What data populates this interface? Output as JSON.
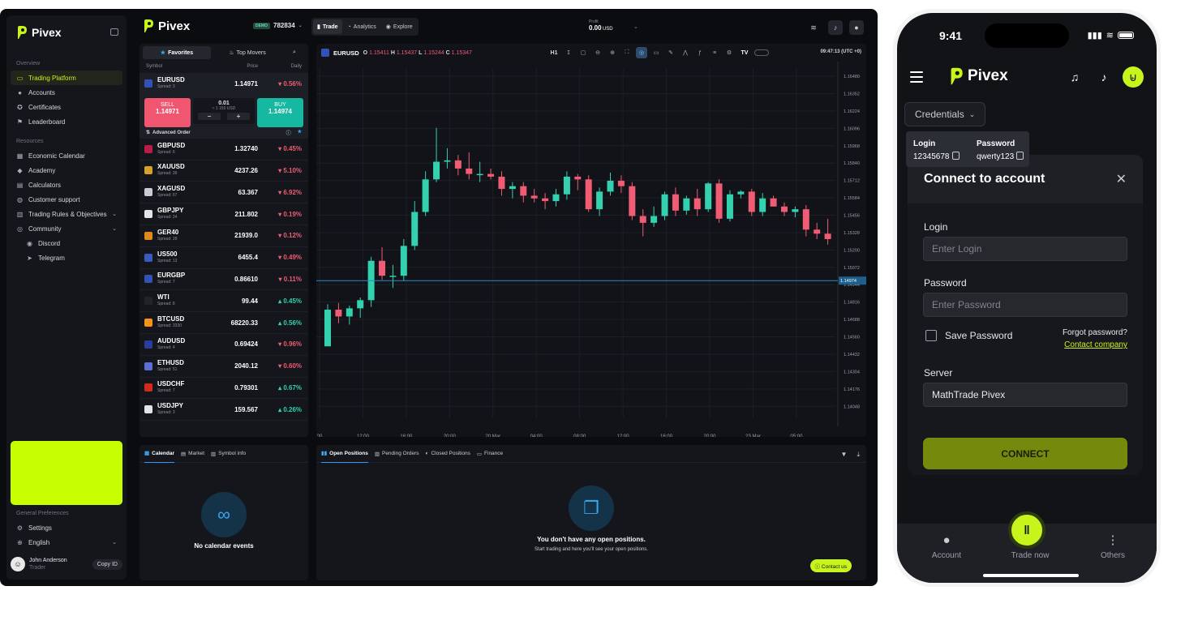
{
  "brand": "Pivex",
  "sidebar": {
    "overview_title": "Overview",
    "overview_items": [
      {
        "label": "Trading Platform",
        "icon": "monitor-icon",
        "active": true
      },
      {
        "label": "Accounts",
        "icon": "user-icon"
      },
      {
        "label": "Certificates",
        "icon": "award-icon"
      },
      {
        "label": "Leaderboard",
        "icon": "flag-icon"
      }
    ],
    "resources_title": "Resources",
    "resources_items": [
      {
        "label": "Economic Calendar",
        "icon": "calendar-icon"
      },
      {
        "label": "Academy",
        "icon": "graduation-icon"
      },
      {
        "label": "Calculators",
        "icon": "calculator-icon"
      },
      {
        "label": "Customer support",
        "icon": "support-icon"
      },
      {
        "label": "Trading Rules & Objectives",
        "icon": "book-icon",
        "chevron": true
      },
      {
        "label": "Community",
        "icon": "globe-icon",
        "chevron": true
      }
    ],
    "community_items": [
      {
        "label": "Discord",
        "icon": "discord-icon"
      },
      {
        "label": "Telegram",
        "icon": "telegram-icon"
      }
    ],
    "prefs_title": "General Preferences",
    "prefs_items": [
      {
        "label": "Settings",
        "icon": "gear-icon"
      },
      {
        "label": "English",
        "icon": "uk-flag-icon",
        "chevron": true
      }
    ],
    "user": {
      "name": "John Anderson",
      "role": "Trader",
      "copy_label": "Copy ID"
    }
  },
  "topbar": {
    "account_badge": "DEMO",
    "account_id": "782834",
    "tabs": [
      "Trade",
      "Analytics",
      "Explore"
    ],
    "profit_label": "Profit",
    "profit_value": "0.00",
    "profit_currency": "USD"
  },
  "watchlist": {
    "tabs": [
      "Favorites",
      "Top Movers"
    ],
    "columns": [
      "Symbol",
      "Price",
      "Daily"
    ],
    "selected": {
      "symbol": "EURUSD",
      "spread": "Spread: 3",
      "price": "1.14971",
      "change": "0.56%",
      "dir": "neg"
    },
    "trade": {
      "sell_label": "SELL",
      "sell_price": "1.14971",
      "buy_label": "BUY",
      "buy_price": "1.14974",
      "lot": "0.01",
      "lot_value": "≈ 1 150 USD",
      "minus": "−",
      "plus": "+"
    },
    "advanced_label": "Advanced Order",
    "rows": [
      {
        "symbol": "GBPUSD",
        "spread": "Spread: 6",
        "price": "1.32740",
        "change": "0.45%",
        "dir": "neg",
        "color": "#b91d47"
      },
      {
        "symbol": "XAUUSD",
        "spread": "Spread: 39",
        "price": "4237.26",
        "change": "5.10%",
        "dir": "neg",
        "color": "#d4a12a"
      },
      {
        "symbol": "XAGUSD",
        "spread": "Spread: 67",
        "price": "63.367",
        "change": "6.92%",
        "dir": "neg",
        "color": "#c9cdd3"
      },
      {
        "symbol": "GBPJPY",
        "spread": "Spread: 24",
        "price": "211.802",
        "change": "0.19%",
        "dir": "neg",
        "color": "#e2e4e8"
      },
      {
        "symbol": "GER40",
        "spread": "Spread: 28",
        "price": "21939.0",
        "change": "0.12%",
        "dir": "neg",
        "color": "#e08a1e"
      },
      {
        "symbol": "US500",
        "spread": "Spread: 13",
        "price": "6455.4",
        "change": "0.49%",
        "dir": "neg",
        "color": "#3a5bbf"
      },
      {
        "symbol": "EURGBP",
        "spread": "Spread: 7",
        "price": "0.86610",
        "change": "0.11%",
        "dir": "neg",
        "color": "#3352b8"
      },
      {
        "symbol": "WTI",
        "spread": "Spread: 8",
        "price": "99.44",
        "change": "0.45%",
        "dir": "pos",
        "color": "#222428"
      },
      {
        "symbol": "BTCUSD",
        "spread": "Spread: 3330",
        "price": "68220.33",
        "change": "0.56%",
        "dir": "pos",
        "color": "#f7931a"
      },
      {
        "symbol": "AUDUSD",
        "spread": "Spread: 4",
        "price": "0.69424",
        "change": "0.96%",
        "dir": "neg",
        "color": "#2a3d9b"
      },
      {
        "symbol": "ETHUSD",
        "spread": "Spread: 51",
        "price": "2040.12",
        "change": "0.60%",
        "dir": "neg",
        "color": "#5b6fd6"
      },
      {
        "symbol": "USDCHF",
        "spread": "Spread: 7",
        "price": "0.79301",
        "change": "0.67%",
        "dir": "pos",
        "color": "#d52b1e"
      },
      {
        "symbol": "USDJPY",
        "spread": "Spread: 3",
        "price": "159.567",
        "change": "0.26%",
        "dir": "pos",
        "color": "#e2e4e8"
      }
    ]
  },
  "chart": {
    "symbol": "EURUSD",
    "open_label": "O",
    "open": "1.15411",
    "high_label": "H",
    "high": "1.15437",
    "low_label": "L",
    "low": "1.15244",
    "close_label": "C",
    "close": "1.15347",
    "timeframe": "H1",
    "time": "09:47:13 (UTC +0)",
    "tv_logo": "TV"
  },
  "chart_data": {
    "type": "candlestick",
    "symbol": "EURUSD",
    "timeframe": "H1",
    "ylim": [
      1.1396,
      1.1654
    ],
    "y_ticks": [
      "1.16480",
      "1.16352",
      "1.16224",
      "1.16096",
      "1.15968",
      "1.15840",
      "1.15712",
      "1.15584",
      "1.15456",
      "1.15328",
      "1.15200",
      "1.15072",
      "1.14944",
      "1.14816",
      "1.14688",
      "1.14560",
      "1.14432",
      "1.14304",
      "1.14176",
      "1.14048"
    ],
    "x_ticks": [
      "00",
      "12:00",
      "16:00",
      "20:00",
      "20 Mar",
      "04:00",
      "08:00",
      "12:00",
      "16:00",
      "20:00",
      "23 Mar",
      "05:00"
    ],
    "current_price": "1.14974",
    "ohlc": [
      [
        1.1449,
        1.148,
        1.1449,
        1.1476
      ],
      [
        1.1476,
        1.1481,
        1.1466,
        1.1471
      ],
      [
        1.1471,
        1.1479,
        1.1465,
        1.1477
      ],
      [
        1.1477,
        1.1485,
        1.147,
        1.1483
      ],
      [
        1.1483,
        1.1515,
        1.1478,
        1.1512
      ],
      [
        1.1512,
        1.1522,
        1.1498,
        1.1501
      ],
      [
        1.1501,
        1.1509,
        1.1492,
        1.1501
      ],
      [
        1.1501,
        1.1528,
        1.1497,
        1.1523
      ],
      [
        1.1523,
        1.1556,
        1.152,
        1.1548
      ],
      [
        1.1548,
        1.1578,
        1.1545,
        1.1572
      ],
      [
        1.1572,
        1.161,
        1.157,
        1.1585
      ],
      [
        1.1585,
        1.1595,
        1.158,
        1.1586
      ],
      [
        1.1586,
        1.159,
        1.1575,
        1.158
      ],
      [
        1.158,
        1.1592,
        1.1572,
        1.1576
      ],
      [
        1.1576,
        1.1585,
        1.157,
        1.1576
      ],
      [
        1.1576,
        1.158,
        1.1572,
        1.1574
      ],
      [
        1.1574,
        1.1578,
        1.156,
        1.1565
      ],
      [
        1.1565,
        1.157,
        1.1558,
        1.1567
      ],
      [
        1.1567,
        1.157,
        1.1555,
        1.156
      ],
      [
        1.156,
        1.1565,
        1.1555,
        1.1558
      ],
      [
        1.1558,
        1.1562,
        1.155,
        1.1556
      ],
      [
        1.1556,
        1.1565,
        1.1552,
        1.1561
      ],
      [
        1.1561,
        1.1578,
        1.1557,
        1.1574
      ],
      [
        1.1574,
        1.1576,
        1.1564,
        1.1572
      ],
      [
        1.1572,
        1.1575,
        1.1548,
        1.155
      ],
      [
        1.155,
        1.1566,
        1.1545,
        1.1563
      ],
      [
        1.1563,
        1.1577,
        1.156,
        1.1571
      ],
      [
        1.1571,
        1.1575,
        1.1562,
        1.1567
      ],
      [
        1.1567,
        1.157,
        1.1542,
        1.1545
      ],
      [
        1.1545,
        1.155,
        1.153,
        1.154
      ],
      [
        1.154,
        1.1552,
        1.1537,
        1.1545
      ],
      [
        1.1545,
        1.1563,
        1.1542,
        1.1561
      ],
      [
        1.1561,
        1.1566,
        1.1545,
        1.1549
      ],
      [
        1.1549,
        1.156,
        1.1546,
        1.1558
      ],
      [
        1.1558,
        1.1565,
        1.1545,
        1.155
      ],
      [
        1.155,
        1.157,
        1.1548,
        1.1569
      ],
      [
        1.1569,
        1.1572,
        1.154,
        1.1543
      ],
      [
        1.1543,
        1.1564,
        1.1541,
        1.1561
      ],
      [
        1.1561,
        1.1564,
        1.1558,
        1.1563
      ],
      [
        1.1563,
        1.1565,
        1.1545,
        1.1548
      ],
      [
        1.1548,
        1.1562,
        1.1545,
        1.1558
      ],
      [
        1.1558,
        1.156,
        1.1552,
        1.1552
      ],
      [
        1.1552,
        1.1555,
        1.1545,
        1.1548
      ],
      [
        1.1548,
        1.1552,
        1.1544,
        1.155
      ],
      [
        1.155,
        1.1553,
        1.153,
        1.1535
      ],
      [
        1.1535,
        1.154,
        1.1528,
        1.1532
      ],
      [
        1.1532,
        1.1543,
        1.1524,
        1.1528
      ]
    ]
  },
  "bottom_left": {
    "tabs": [
      "Calendar",
      "Market",
      "Symbol info"
    ],
    "empty_text": "No calendar events"
  },
  "bottom_right": {
    "tabs": [
      "Open Positions",
      "Pending Orders",
      "Closed Positions",
      "Finance"
    ],
    "empty_title": "You don't have any open positions.",
    "empty_sub": "Start trading and here you'll see your open positions.",
    "contact_label": "Contact us"
  },
  "phone": {
    "time": "9:41",
    "credentials_label": "Credentials",
    "tooltip": {
      "login_label": "Login",
      "login_value": "12345678",
      "password_label": "Password",
      "password_value": "qwerty123"
    },
    "modal": {
      "title": "Connect to account",
      "login_label": "Login",
      "login_placeholder": "Enter Login",
      "password_label": "Password",
      "password_placeholder": "Enter Password",
      "save_password": "Save Password",
      "forgot": "Forgot password?",
      "contact_company": "Contact company",
      "server_label": "Server",
      "server_value": "MathTrade Pivex",
      "connect_label": "CONNECT"
    },
    "tabbar": {
      "account": "Account",
      "trade_now": "Trade now",
      "others": "Others"
    }
  },
  "colors": {
    "accent": "#c6f41c",
    "up": "#33d1b0",
    "down": "#f05c74",
    "sell": "#f15670",
    "buy": "#16b8a1"
  }
}
